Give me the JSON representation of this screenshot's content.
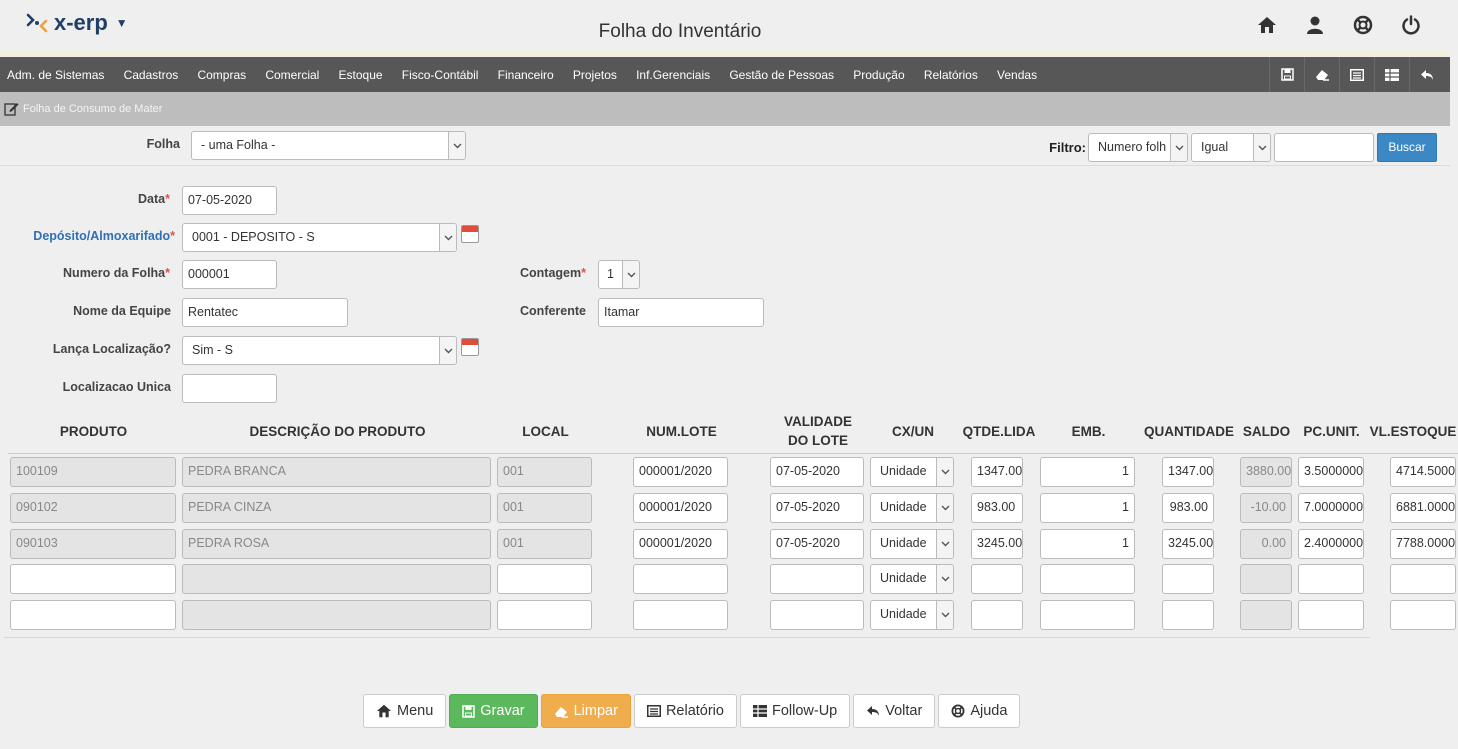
{
  "app": {
    "logo_text": "x-erp",
    "page_title": "Folha do Inventário"
  },
  "menu": [
    "Adm. de Sistemas",
    "Cadastros",
    "Compras",
    "Comercial",
    "Estoque",
    "Fisco-Contábil",
    "Financeiro",
    "Projetos",
    "Inf.Gerenciais",
    "Gestão de Pessoas",
    "Produção",
    "Relatórios",
    "Vendas"
  ],
  "breadcrumb": "Folha de Consumo de Mater",
  "folha": {
    "label": "Folha",
    "value": "- uma Folha -"
  },
  "filtro": {
    "label": "Filtro:",
    "field": "Numero folh",
    "operator": "Igual",
    "value": "",
    "button": "Buscar"
  },
  "form": {
    "data": {
      "label": "Data",
      "value": "07-05-2020"
    },
    "deposito": {
      "label": "Depósito/Almoxarifado",
      "value": "0001 - DEPOSITO - S"
    },
    "numero_folha": {
      "label": "Numero da Folha",
      "value": "000001"
    },
    "contagem": {
      "label": "Contagem",
      "value": "1"
    },
    "nome_equipe": {
      "label": "Nome da Equipe",
      "value": "Rentatec"
    },
    "conferente": {
      "label": "Conferente",
      "value": "Itamar"
    },
    "lanca_localizacao": {
      "label": "Lança Localização?",
      "value": "Sim - S"
    },
    "localizacao_unica": {
      "label": "Localizacao Unica",
      "value": ""
    }
  },
  "table": {
    "headers": {
      "produto": "PRODUTO",
      "descricao": "DESCRIÇÃO DO PRODUTO",
      "local": "LOCAL",
      "num_lote": "NUM.LOTE",
      "validade_1": "VALIDADE",
      "validade_2": "DO LOTE",
      "cx_un": "CX/UN",
      "qtde_lida": "QTDE.LIDA",
      "emb": "EMB.",
      "quantidade": "QUANTIDADE",
      "saldo": "SALDO",
      "pc_unit": "PC.UNIT.",
      "vl_estoque": "VL.ESTOQUE"
    },
    "rows": [
      {
        "produto": "100109",
        "descricao": "PEDRA BRANCA",
        "local": "001",
        "num_lote": "000001/2020",
        "validade": "07-05-2020",
        "cx_un": "Unidade",
        "qtde_lida": "1347.00",
        "emb": "1",
        "quantidade": "1347.00",
        "saldo": "3880.00",
        "pc_unit": "3.5000000",
        "vl_estoque": "4714.5000"
      },
      {
        "produto": "090102",
        "descricao": "PEDRA CINZA",
        "local": "001",
        "num_lote": "000001/2020",
        "validade": "07-05-2020",
        "cx_un": "Unidade",
        "qtde_lida": "983.00",
        "emb": "1",
        "quantidade": "983.00",
        "saldo": "-10.00",
        "pc_unit": "7.0000000",
        "vl_estoque": "6881.0000"
      },
      {
        "produto": "090103",
        "descricao": "PEDRA ROSA",
        "local": "001",
        "num_lote": "000001/2020",
        "validade": "07-05-2020",
        "cx_un": "Unidade",
        "qtde_lida": "3245.00",
        "emb": "1",
        "quantidade": "3245.00",
        "saldo": "0.00",
        "pc_unit": "2.4000000",
        "vl_estoque": "7788.0000"
      },
      {
        "produto": "",
        "descricao": "",
        "local": "",
        "num_lote": "",
        "validade": "",
        "cx_un": "Unidade",
        "qtde_lida": "",
        "emb": "",
        "quantidade": "",
        "saldo": "",
        "pc_unit": "",
        "vl_estoque": ""
      },
      {
        "produto": "",
        "descricao": "",
        "local": "",
        "num_lote": "",
        "validade": "",
        "cx_un": "Unidade",
        "qtde_lida": "",
        "emb": "",
        "quantidade": "",
        "saldo": "",
        "pc_unit": "",
        "vl_estoque": ""
      }
    ]
  },
  "buttons": {
    "menu": "Menu",
    "gravar": "Gravar",
    "limpar": "Limpar",
    "relatorio": "Relatório",
    "followup": "Follow-Up",
    "voltar": "Voltar",
    "ajuda": "Ajuda"
  },
  "colors": {
    "menubar": "#575757",
    "buscar": "#3b88c4",
    "gravar": "#5cb85c",
    "limpar": "#f0ad4e",
    "logo": "#1f3f68",
    "required": "#d9534f"
  }
}
